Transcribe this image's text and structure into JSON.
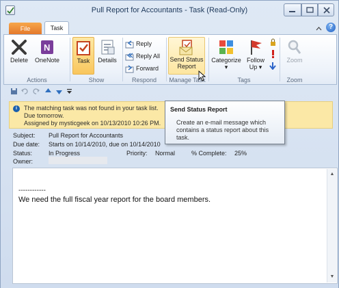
{
  "window": {
    "title": "Pull Report for Accountants - Task (Read-Only)",
    "minimize_icon": "minimize-icon",
    "maximize_icon": "maximize-icon",
    "close_icon": "close-icon"
  },
  "tabs": {
    "file": "File",
    "task": "Task",
    "minimize_ribbon": "⌂",
    "help": "?"
  },
  "ribbon": {
    "groups": {
      "actions": "Actions",
      "show": "Show",
      "respond": "Respond",
      "manage_task": "Manage Task",
      "tags": "Tags",
      "zoom": "Zoom"
    },
    "buttons": {
      "delete": "Delete",
      "onenote": "OneNote",
      "task": "Task",
      "details": "Details",
      "reply": "Reply",
      "reply_all": "Reply All",
      "forward": "Forward",
      "send_status_line1": "Send Status",
      "send_status_line2": "Report",
      "categorize": "Categorize",
      "categorize_arrow": "▾",
      "follow_line1": "Follow",
      "follow_line2": "Up ▾",
      "zoom": "Zoom"
    }
  },
  "infobar": {
    "line1": "The matching task was not found in your task list.",
    "line2": "Due tomorrow.",
    "line3": "Assigned by mysticgeek on 10/13/2010 10:26 PM."
  },
  "tooltip": {
    "title": "Send Status Report",
    "body": "Create an e-mail message which contains a status report about this task."
  },
  "fields": {
    "subject_label": "Subject:",
    "subject_value": "Pull Report for Accountants",
    "due_label": "Due date:",
    "due_value": "Starts on 10/14/2010, due on 10/14/2010",
    "status_label": "Status:",
    "status_value": "In Progress",
    "priority_label": "Priority:",
    "priority_value": "Normal",
    "complete_label": "% Complete:",
    "complete_value": "25%",
    "owner_label": "Owner:"
  },
  "body": {
    "separator": "------------",
    "text": "We need the full fiscal year report for the board members."
  },
  "colors": {
    "accent_file_tab": "#e3762a",
    "infobar_bg": "#fbe8a6"
  }
}
